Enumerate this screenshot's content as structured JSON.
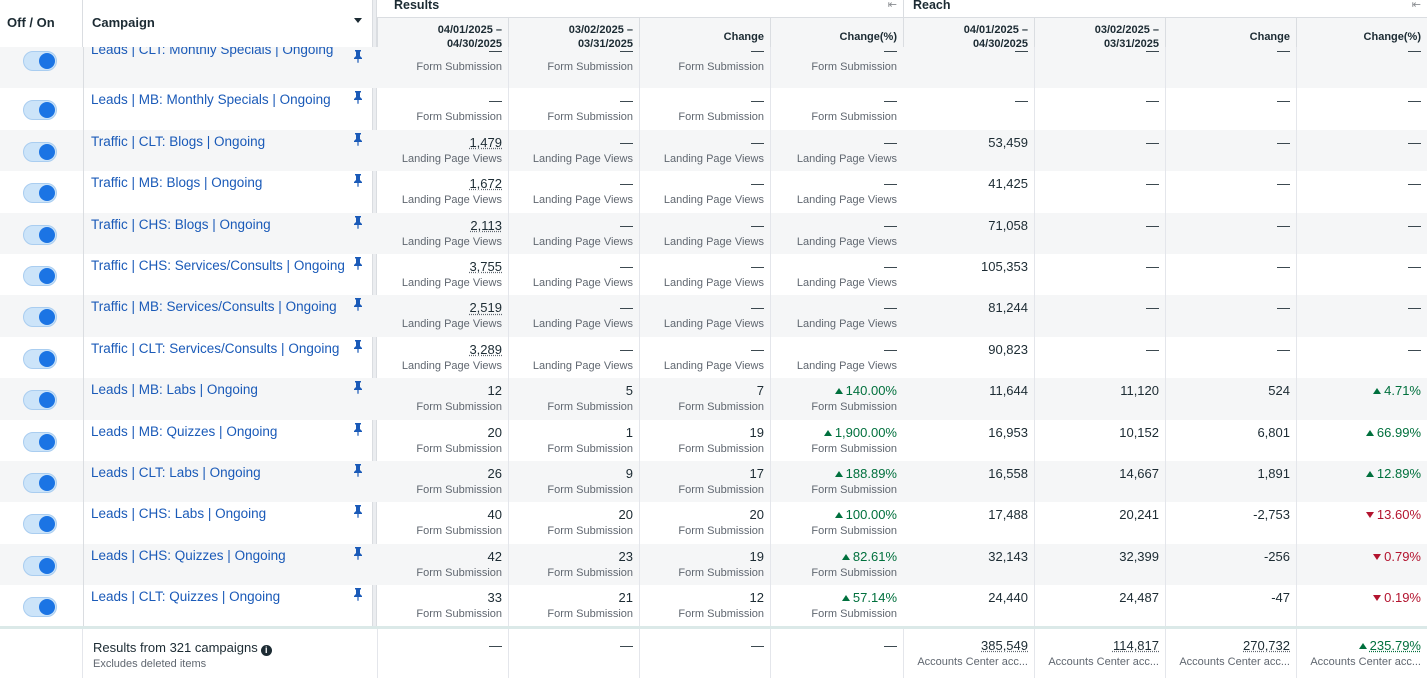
{
  "header": {
    "toggle_col": "Off / On",
    "name_col": "Campaign",
    "groups": [
      {
        "label": "Results"
      },
      {
        "label": "Reach"
      }
    ],
    "sub": [
      "04/01/2025 –\n04/30/2025",
      "03/02/2025 –\n03/31/2025",
      "Change",
      "Change(%)",
      "04/01/2025 –\n04/30/2025",
      "03/02/2025 –\n03/31/2025",
      "Change",
      "Change(%)"
    ]
  },
  "rows": [
    {
      "name": "Leads | CLT: Monthly Specials | Ongoing",
      "r": [
        "—",
        "—",
        "—",
        "—"
      ],
      "rs": "Form Submission",
      "reach": [
        "—",
        "—",
        "—",
        "—"
      ],
      "partial": true
    },
    {
      "name": "Leads | MB: Monthly Specials | Ongoing",
      "r": [
        "—",
        "—",
        "—",
        "—"
      ],
      "rs": "Form Submission",
      "reach": [
        "—",
        "—",
        "—",
        "—"
      ]
    },
    {
      "name": "Traffic | CLT: Blogs | Ongoing",
      "r": [
        "1,479",
        "—",
        "—",
        "—"
      ],
      "rs": "Landing Page Views",
      "reach": [
        "53,459",
        "—",
        "—",
        "—"
      ]
    },
    {
      "name": "Traffic | MB: Blogs | Ongoing",
      "r": [
        "1,672",
        "—",
        "—",
        "—"
      ],
      "rs": "Landing Page Views",
      "reach": [
        "41,425",
        "—",
        "—",
        "—"
      ]
    },
    {
      "name": "Traffic | CHS: Blogs | Ongoing",
      "r": [
        "2,113",
        "—",
        "—",
        "—"
      ],
      "rs": "Landing Page Views",
      "reach": [
        "71,058",
        "—",
        "—",
        "—"
      ]
    },
    {
      "name": "Traffic | CHS: Services/Consults | Ongoing",
      "r": [
        "3,755",
        "—",
        "—",
        "—"
      ],
      "rs": "Landing Page Views",
      "reach": [
        "105,353",
        "—",
        "—",
        "—"
      ]
    },
    {
      "name": "Traffic | MB: Services/Consults | Ongoing",
      "r": [
        "2,519",
        "—",
        "—",
        "—"
      ],
      "rs": "Landing Page Views",
      "reach": [
        "81,244",
        "—",
        "—",
        "—"
      ]
    },
    {
      "name": "Traffic | CLT: Services/Consults | Ongoing",
      "r": [
        "3,289",
        "—",
        "—",
        "—"
      ],
      "rs": "Landing Page Views",
      "reach": [
        "90,823",
        "—",
        "—",
        "—"
      ]
    },
    {
      "name": "Leads | MB: Labs | Ongoing",
      "r": [
        "12",
        "5",
        "7",
        "140.00%"
      ],
      "rs": "Form Submission",
      "reach": [
        "11,644",
        "11,120",
        "524",
        "4.71%"
      ],
      "dir": "up",
      "rdir": "up"
    },
    {
      "name": "Leads | MB: Quizzes | Ongoing",
      "r": [
        "20",
        "1",
        "19",
        "1,900.00%"
      ],
      "rs": "Form Submission",
      "reach": [
        "16,953",
        "10,152",
        "6,801",
        "66.99%"
      ],
      "dir": "up",
      "rdir": "up"
    },
    {
      "name": "Leads | CLT: Labs | Ongoing",
      "r": [
        "26",
        "9",
        "17",
        "188.89%"
      ],
      "rs": "Form Submission",
      "reach": [
        "16,558",
        "14,667",
        "1,891",
        "12.89%"
      ],
      "dir": "up",
      "rdir": "up"
    },
    {
      "name": "Leads | CHS: Labs | Ongoing",
      "r": [
        "40",
        "20",
        "20",
        "100.00%"
      ],
      "rs": "Form Submission",
      "reach": [
        "17,488",
        "20,241",
        "-2,753",
        "13.60%"
      ],
      "dir": "up",
      "rdir": "down"
    },
    {
      "name": "Leads | CHS: Quizzes | Ongoing",
      "r": [
        "42",
        "23",
        "19",
        "82.61%"
      ],
      "rs": "Form Submission",
      "reach": [
        "32,143",
        "32,399",
        "-256",
        "0.79%"
      ],
      "dir": "up",
      "rdir": "down"
    },
    {
      "name": "Leads | CLT: Quizzes | Ongoing",
      "r": [
        "33",
        "21",
        "12",
        "57.14%"
      ],
      "rs": "Form Submission",
      "reach": [
        "24,440",
        "24,487",
        "-47",
        "0.19%"
      ],
      "dir": "up",
      "rdir": "down"
    }
  ],
  "footer": {
    "title": "Results from 321 campaigns",
    "subtitle": "Excludes deleted items",
    "r": [
      "—",
      "—",
      "—",
      "—"
    ],
    "reach": [
      "385,549",
      "114,817",
      "270,732",
      "235.79%"
    ],
    "reach_sub": "Accounts Center acc..."
  },
  "colors": {
    "link": "#1a5ab8",
    "up": "#00703d",
    "down": "#b3142f",
    "toggle": "#1b74e4"
  }
}
